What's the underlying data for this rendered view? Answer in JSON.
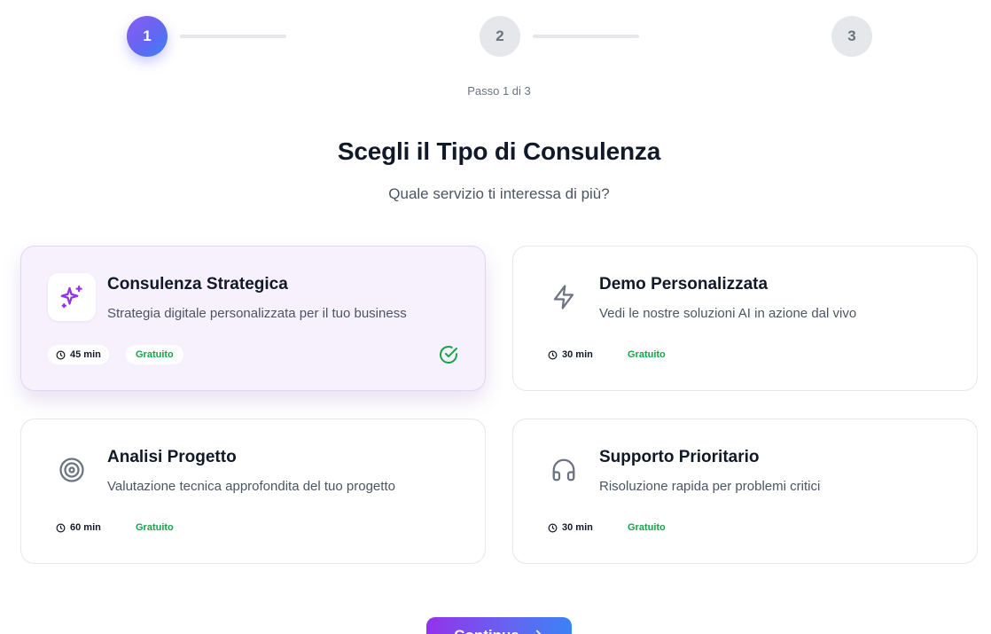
{
  "stepper": {
    "steps": [
      {
        "number": "1",
        "state": "active"
      },
      {
        "number": "2",
        "state": "inactive"
      },
      {
        "number": "3",
        "state": "inactive"
      }
    ],
    "caption": "Passo 1 di 3"
  },
  "header": {
    "title": "Scegli il Tipo di Consulenza",
    "subtitle": "Quale servizio ti interessa di più?"
  },
  "cards": [
    {
      "title": "Consulenza Strategica",
      "description": "Strategia digitale personalizzata per il tuo business",
      "duration": "45 min",
      "price": "Gratuito",
      "icon": "sparkles-icon",
      "selected": true
    },
    {
      "title": "Demo Personalizzata",
      "description": "Vedi le nostre soluzioni AI in azione dal vivo",
      "duration": "30 min",
      "price": "Gratuito",
      "icon": "lightning-icon",
      "selected": false
    },
    {
      "title": "Analisi Progetto",
      "description": "Valutazione tecnica approfondita del tuo progetto",
      "duration": "60 min",
      "price": "Gratuito",
      "icon": "target-icon",
      "selected": false
    },
    {
      "title": "Supporto Prioritario",
      "description": "Risoluzione rapida per problemi critici",
      "duration": "30 min",
      "price": "Gratuito",
      "icon": "headphones-icon",
      "selected": false
    }
  ],
  "actions": {
    "continue_label": "Continua",
    "continue_icon": "arrow-right-icon"
  },
  "colors": {
    "accent_purple": "#9333ea",
    "accent_blue": "#3b82f6",
    "success_green": "#16a34a",
    "selected_bg": "#f7f1fd"
  }
}
